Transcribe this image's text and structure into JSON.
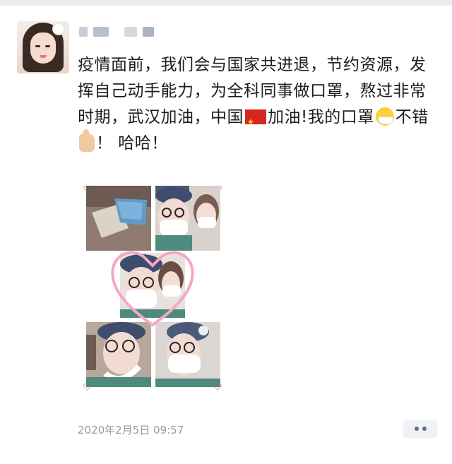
{
  "post": {
    "text_before_flag": "疫情面前，我们会与国家共进退，节约资源，发挥自己动手能力，为全科同事做口罩，熬过非常时期，武汉加油，中国",
    "text_after_flag": "加油!我的口罩",
    "text_after_mask_emoji": "不错",
    "text_after_thumb_emoji": "！ 哈哈！",
    "timestamp": "2020年2月5日 09:57"
  },
  "icons": {
    "flag": "china-flag-icon",
    "mask_emoji": "face-with-medical-mask-icon",
    "thumb_emoji": "thumbs-up-icon",
    "more": "more-dots-icon"
  },
  "colors": {
    "timestamp": "#999999",
    "more_dots": "#5b6b95",
    "heart_frame": "#f4a7c4"
  }
}
